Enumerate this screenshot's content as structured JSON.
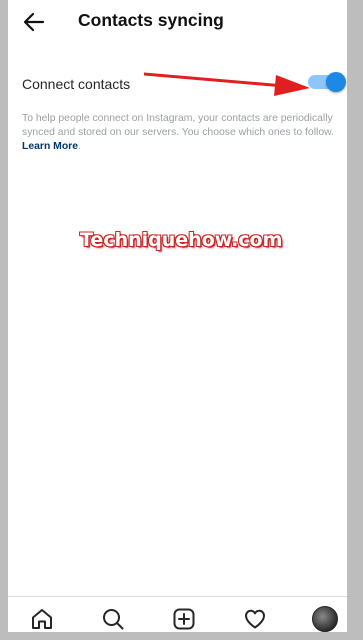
{
  "header": {
    "title": "Contacts syncing",
    "back_icon": "arrow-left-icon"
  },
  "setting": {
    "label": "Connect contacts",
    "toggle_on": true,
    "toggle_color": "#1e88e5",
    "toggle_track_color": "#8ec5fb"
  },
  "description": {
    "text": "To help people connect on Instagram, your contacts are periodically synced and stored on our servers. You choose which ones to follow. ",
    "link": "Learn More",
    "trailing": "."
  },
  "annotation": {
    "arrow_color": "#e02020",
    "watermark": "Techniquehow.com"
  },
  "bottom_nav": {
    "items": [
      "home-icon",
      "search-icon",
      "new-post-icon",
      "activity-heart-icon",
      "profile-avatar"
    ]
  }
}
